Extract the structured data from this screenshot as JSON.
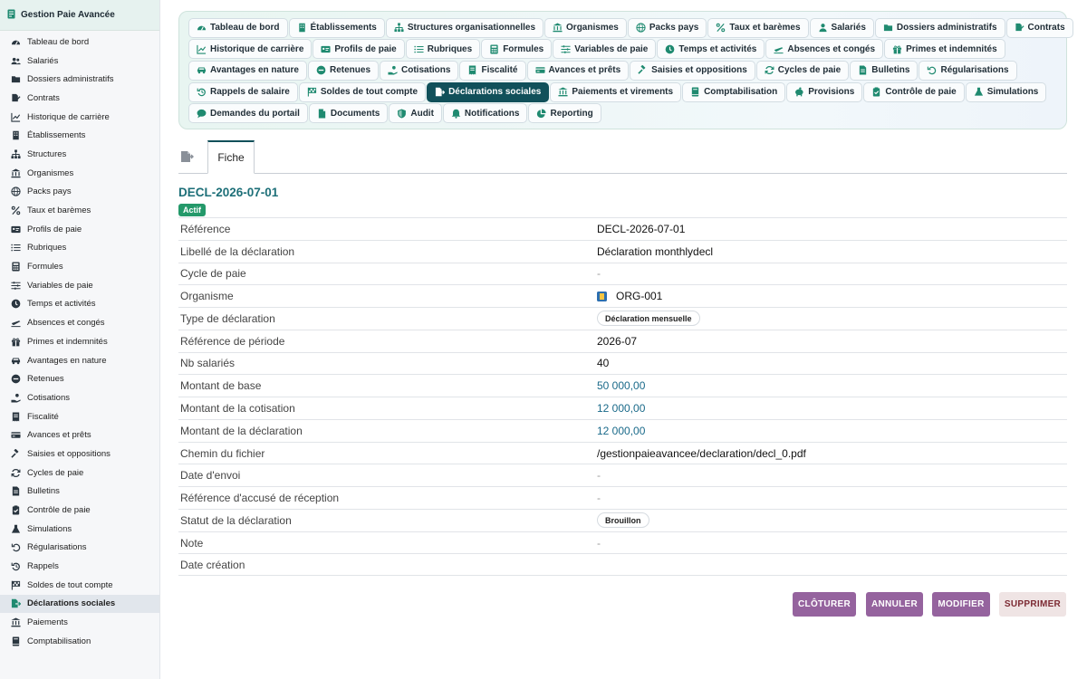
{
  "app": {
    "title": "Gestion Paie Avancée",
    "accent": "#11505a"
  },
  "sidebar": {
    "items": [
      {
        "label": "Tableau de bord",
        "icon": "gauge-icon"
      },
      {
        "label": "Salariés",
        "icon": "users-icon"
      },
      {
        "label": "Dossiers administratifs",
        "icon": "folder-icon"
      },
      {
        "label": "Contrats",
        "icon": "file-signature-icon"
      },
      {
        "label": "Historique de carrière",
        "icon": "chart-line-icon"
      },
      {
        "label": "Établissements",
        "icon": "building-icon"
      },
      {
        "label": "Structures",
        "icon": "sitemap-icon"
      },
      {
        "label": "Organismes",
        "icon": "landmark-icon"
      },
      {
        "label": "Packs pays",
        "icon": "globe-icon"
      },
      {
        "label": "Taux et barèmes",
        "icon": "percent-icon"
      },
      {
        "label": "Profils de paie",
        "icon": "id-card-icon"
      },
      {
        "label": "Rubriques",
        "icon": "list-icon"
      },
      {
        "label": "Formules",
        "icon": "calculator-icon"
      },
      {
        "label": "Variables de paie",
        "icon": "sliders-icon"
      },
      {
        "label": "Temps et activités",
        "icon": "clock-icon"
      },
      {
        "label": "Absences et congés",
        "icon": "plane-icon"
      },
      {
        "label": "Primes et indemnités",
        "icon": "gift-icon"
      },
      {
        "label": "Avantages en nature",
        "icon": "car-icon"
      },
      {
        "label": "Retenues",
        "icon": "minus-circle-icon"
      },
      {
        "label": "Cotisations",
        "icon": "hand-coins-icon"
      },
      {
        "label": "Fiscalité",
        "icon": "receipt-icon"
      },
      {
        "label": "Avances et prêts",
        "icon": "money-bill-icon"
      },
      {
        "label": "Saisies et oppositions",
        "icon": "gavel-icon"
      },
      {
        "label": "Cycles de paie",
        "icon": "sync-icon"
      },
      {
        "label": "Bulletins",
        "icon": "file-invoice-icon"
      },
      {
        "label": "Contrôle de paie",
        "icon": "clipboard-check-icon"
      },
      {
        "label": "Simulations",
        "icon": "flask-icon"
      },
      {
        "label": "Régularisations",
        "icon": "undo-icon"
      },
      {
        "label": "Rappels",
        "icon": "history-icon"
      },
      {
        "label": "Soldes de tout compte",
        "icon": "flag-checkered-icon"
      },
      {
        "label": "Déclarations sociales",
        "icon": "file-export-icon",
        "active": true
      },
      {
        "label": "Paiements",
        "icon": "bank-icon"
      },
      {
        "label": "Comptabilisation",
        "icon": "book-icon"
      }
    ]
  },
  "tabs": {
    "rows": [
      [
        {
          "label": "Tableau de bord",
          "icon": "gauge-icon"
        },
        {
          "label": "Établissements",
          "icon": "building-icon"
        },
        {
          "label": "Structures organisationnelles",
          "icon": "sitemap-icon"
        },
        {
          "label": "Organismes",
          "icon": "landmark-icon"
        },
        {
          "label": "Packs pays",
          "icon": "globe-icon"
        },
        {
          "label": "Taux et barèmes",
          "icon": "percent-icon"
        },
        {
          "label": "Salariés",
          "icon": "user-icon"
        },
        {
          "label": "Dossiers administratifs",
          "icon": "folder-icon"
        },
        {
          "label": "Contrats",
          "icon": "file-signature-icon"
        }
      ],
      [
        {
          "label": "Historique de carrière",
          "icon": "chart-line-icon"
        },
        {
          "label": "Profils de paie",
          "icon": "id-card-icon"
        },
        {
          "label": "Rubriques",
          "icon": "list-icon"
        },
        {
          "label": "Formules",
          "icon": "calculator-icon"
        },
        {
          "label": "Variables de paie",
          "icon": "sliders-icon"
        },
        {
          "label": "Temps et activités",
          "icon": "clock-icon"
        },
        {
          "label": "Absences et congés",
          "icon": "plane-icon"
        },
        {
          "label": "Primes et indemnités",
          "icon": "gift-icon"
        }
      ],
      [
        {
          "label": "Avantages en nature",
          "icon": "car-icon"
        },
        {
          "label": "Retenues",
          "icon": "minus-circle-icon"
        },
        {
          "label": "Cotisations",
          "icon": "hand-coins-icon"
        },
        {
          "label": "Fiscalité",
          "icon": "receipt-icon"
        },
        {
          "label": "Avances et prêts",
          "icon": "money-bill-icon"
        },
        {
          "label": "Saisies et oppositions",
          "icon": "gavel-icon"
        },
        {
          "label": "Cycles de paie",
          "icon": "sync-icon"
        },
        {
          "label": "Bulletins",
          "icon": "file-invoice-icon"
        },
        {
          "label": "Régularisations",
          "icon": "undo-icon"
        }
      ],
      [
        {
          "label": "Rappels de salaire",
          "icon": "history-icon"
        },
        {
          "label": "Soldes de tout compte",
          "icon": "flag-checkered-icon"
        },
        {
          "label": "Déclarations sociales",
          "icon": "file-export-icon",
          "active": true
        },
        {
          "label": "Paiements et virements",
          "icon": "bank-icon"
        },
        {
          "label": "Comptabilisation",
          "icon": "book-icon"
        },
        {
          "label": "Provisions",
          "icon": "piggy-bank-icon"
        },
        {
          "label": "Contrôle de paie",
          "icon": "clipboard-check-icon"
        },
        {
          "label": "Simulations",
          "icon": "flask-icon"
        }
      ],
      [
        {
          "label": "Demandes du portail",
          "icon": "comment-icon"
        },
        {
          "label": "Documents",
          "icon": "file-icon"
        },
        {
          "label": "Audit",
          "icon": "shield-icon"
        },
        {
          "label": "Notifications",
          "icon": "bell-icon"
        },
        {
          "label": "Reporting",
          "icon": "pie-chart-icon"
        }
      ]
    ]
  },
  "subtabs": {
    "back_icon": "file-export-icon",
    "fiche_label": "Fiche"
  },
  "record": {
    "id": "DECL-2026-07-01",
    "status": "Actif",
    "status_color": "#24996a"
  },
  "fields": [
    {
      "label": "Référence",
      "value": "DECL-2026-07-01",
      "kind": "text"
    },
    {
      "label": "Libellé de la déclaration",
      "value": "Déclaration monthlydecl",
      "kind": "text"
    },
    {
      "label": "Cycle de paie",
      "value": "-",
      "kind": "muted"
    },
    {
      "label": "Organisme",
      "value": "ORG-001",
      "kind": "org"
    },
    {
      "label": "Type de déclaration",
      "value": "Déclaration mensuelle",
      "kind": "chip"
    },
    {
      "label": "Référence de période",
      "value": "2026-07",
      "kind": "text"
    },
    {
      "label": "Nb salariés",
      "value": "40",
      "kind": "text"
    },
    {
      "label": "Montant de base",
      "value": "50 000,00",
      "kind": "link"
    },
    {
      "label": "Montant de la cotisation",
      "value": "12 000,00",
      "kind": "link"
    },
    {
      "label": "Montant de la déclaration",
      "value": "12 000,00",
      "kind": "link"
    },
    {
      "label": "Chemin du fichier",
      "value": "/gestionpaieavancee/declaration/decl_0.pdf",
      "kind": "text"
    },
    {
      "label": "Date d'envoi",
      "value": "-",
      "kind": "muted"
    },
    {
      "label": "Référence d'accusé de réception",
      "value": "-",
      "kind": "muted"
    },
    {
      "label": "Statut de la déclaration",
      "value": "Brouillon",
      "kind": "chip"
    },
    {
      "label": "Note",
      "value": "-",
      "kind": "muted"
    },
    {
      "label": "Date création",
      "value": "",
      "kind": "text"
    }
  ],
  "actions": {
    "cloturer": "CLÔTURER",
    "annuler": "ANNULER",
    "modifier": "MODIFIER",
    "supprimer": "SUPPRIMER"
  }
}
